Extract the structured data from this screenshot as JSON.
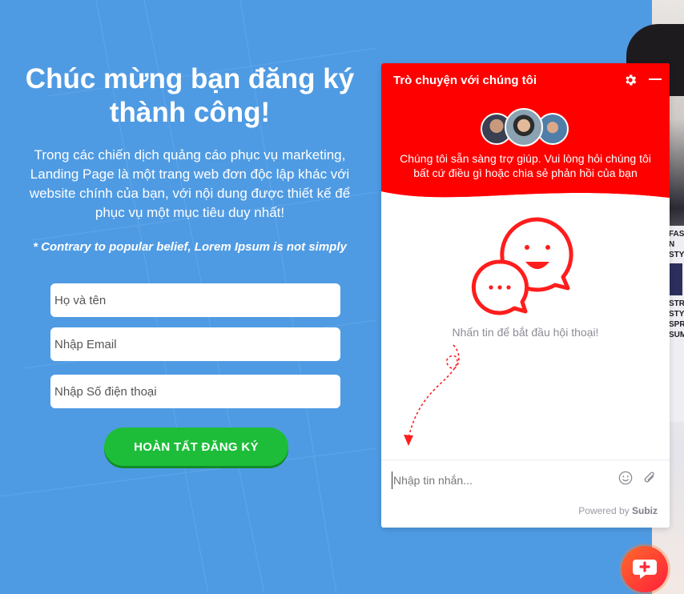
{
  "hero": {
    "title": "Chúc mừng bạn đăng ký thành công!",
    "lead": "Trong các chiến dịch quảng cáo phục vụ marketing, Landing Page là một trang web đơn độc lập khác với website chính của bạn, với nội dung được thiết kế để phục vụ một mục tiêu duy nhất!",
    "note": "* Contrary to popular belief, Lorem Ipsum is not simply"
  },
  "form": {
    "name_placeholder": "Họ và tên",
    "email_placeholder": "Nhập Email",
    "phone_placeholder": "Nhập Số điện thoại",
    "submit_label": "HOÀN TẤT ĐĂNG KÝ"
  },
  "chat": {
    "title": "Trò chuyện với chúng tôi",
    "subtitle": "Chúng tôi sẵn sàng trợ giúp. Vui lòng hỏi chúng tôi bất cứ điều gì hoặc chia sẻ phản hồi của bạn",
    "empty_text": "Nhấn tin để bắt đầu hội thoại!",
    "input_placeholder": "Nhập tin nhắn...",
    "powered_prefix": "Powered by",
    "powered_brand": "Subiz",
    "accent_color": "#ff0000"
  },
  "poster": {
    "lines": [
      "FAS",
      "N",
      "STY",
      "STR",
      "STY",
      "SPR",
      "SUM"
    ]
  },
  "icons": {
    "gear": "gear-icon",
    "minimize": "minimize-icon",
    "emoji": "smiley-icon",
    "attach": "paperclip-icon",
    "launcher": "chat-plus-icon"
  },
  "colors": {
    "background": "#4f9be3",
    "cta": "#1dbd3a",
    "chat_header": "#ff0000"
  }
}
